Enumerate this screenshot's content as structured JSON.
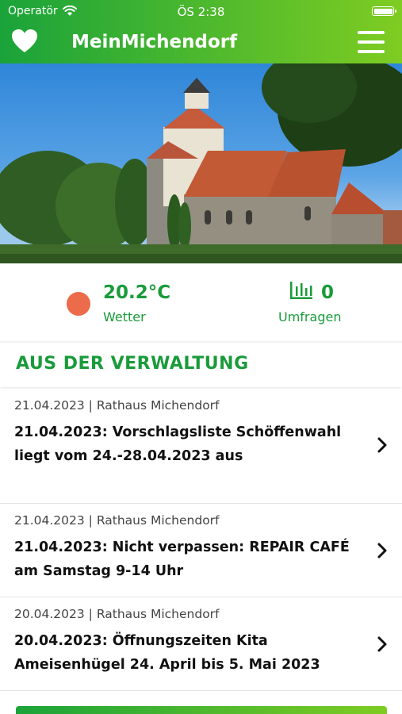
{
  "status_bar": {
    "carrier": "Operatör",
    "time": "ÖS 2:38"
  },
  "nav": {
    "title": "MeinMichendorf"
  },
  "stats": {
    "weather_value": "20.2°C",
    "weather_label": "Wetter",
    "polls_value": "0",
    "polls_label": "Umfragen"
  },
  "section": {
    "title": "AUS DER VERWALTUNG"
  },
  "news": [
    {
      "meta": "21.04.2023 | Rathaus Michendorf",
      "title": "21.04.2023: Vorschlagsliste Schöffenwahl liegt vom 24.-28.04.2023 aus"
    },
    {
      "meta": "21.04.2023 | Rathaus Michendorf",
      "title": "21.04.2023: Nicht verpassen: REPAIR CAFÉ am Samstag 9-14 Uhr"
    },
    {
      "meta": "20.04.2023 | Rathaus Michendorf",
      "title": "20.04.2023: Öffnungszeiten Kita Ameisenhügel 24. April bis 5. Mai 2023"
    }
  ],
  "colors": {
    "brand_green": "#1a9b3a",
    "weather_dot": "#ec6b4a"
  }
}
